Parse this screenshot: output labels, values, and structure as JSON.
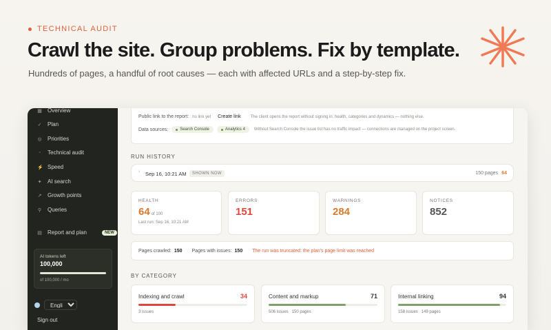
{
  "hero": {
    "eyebrow": "TECHNICAL AUDIT",
    "title": "Crawl the site. Group problems. Fix by template.",
    "subtitle": "Hundreds of pages, a handful of root causes — each with affected URLs and a step-by-step fix."
  },
  "colors": {
    "accent": "#e0603a",
    "good": "#7ea06a",
    "bad": "#e0453a",
    "warn": "#d97a2e"
  },
  "sidebar": {
    "items": [
      {
        "label": "Overview",
        "icon": "grid-icon"
      },
      {
        "label": "Plan",
        "icon": "check-icon"
      },
      {
        "label": "Priorities",
        "icon": "target-icon"
      },
      {
        "label": "Technical audit",
        "icon": "dot-icon"
      },
      {
        "label": "Speed",
        "icon": "bolt-icon"
      },
      {
        "label": "AI search",
        "icon": "sparkle-icon"
      },
      {
        "label": "Growth points",
        "icon": "arrows-icon"
      },
      {
        "label": "Queries",
        "icon": "search-icon"
      }
    ],
    "report": {
      "label": "Report and plan",
      "badge": "NEW",
      "icon": "document-icon"
    },
    "tokens": {
      "title": "AI tokens left",
      "value": "100,000",
      "caption": "of 100,000 / mo",
      "fill": 1.0
    },
    "language": "English",
    "sign_out": "Sign out"
  },
  "share": {
    "public_link_label": "Public link to the report:",
    "no_link": "no link yet",
    "create_link": "Create link",
    "public_link_note": "The client opens the report without signing in: health, categories and dynamics — nothing else.",
    "data_sources_label": "Data sources:",
    "sources": [
      "Search Console",
      "Analytics 4"
    ],
    "sources_note": "Without Search Console the issue list has no traffic impact — connections are managed on the project screen."
  },
  "run_history": {
    "title": "RUN HISTORY",
    "date": "Sep 16, 10:21 AM",
    "tag": "SHOWN NOW",
    "pages": "150 pages",
    "score": "64"
  },
  "metrics": {
    "health": {
      "label": "HEALTH",
      "value": "64",
      "of": "of 100",
      "last_run": "Last run: Sep 16, 10:21 AM"
    },
    "errors": {
      "label": "ERRORS",
      "value": "151"
    },
    "warnings": {
      "label": "WARNINGS",
      "value": "284"
    },
    "notices": {
      "label": "NOTICES",
      "value": "852"
    }
  },
  "crawl": {
    "pages_crawled_label": "Pages crawled:",
    "pages_crawled": "150",
    "pages_with_issues_label": "Pages with issues:",
    "pages_with_issues": "150",
    "truncated": "The run was truncated: the plan's page limit was reached"
  },
  "categories": {
    "title": "BY CATEGORY",
    "items": [
      {
        "name": "Indexing and crawl",
        "score": "34",
        "fill": 0.34,
        "color": "#e0453a",
        "issues": "3 issues",
        "pages": ""
      },
      {
        "name": "Content and markup",
        "score": "71",
        "fill": 0.71,
        "color": "#7ea06a",
        "issues": "506 issues",
        "pages": "150 pages"
      },
      {
        "name": "Internal linking",
        "score": "94",
        "fill": 0.94,
        "color": "#7ea06a",
        "issues": "158 issues",
        "pages": "149 pages"
      }
    ]
  }
}
